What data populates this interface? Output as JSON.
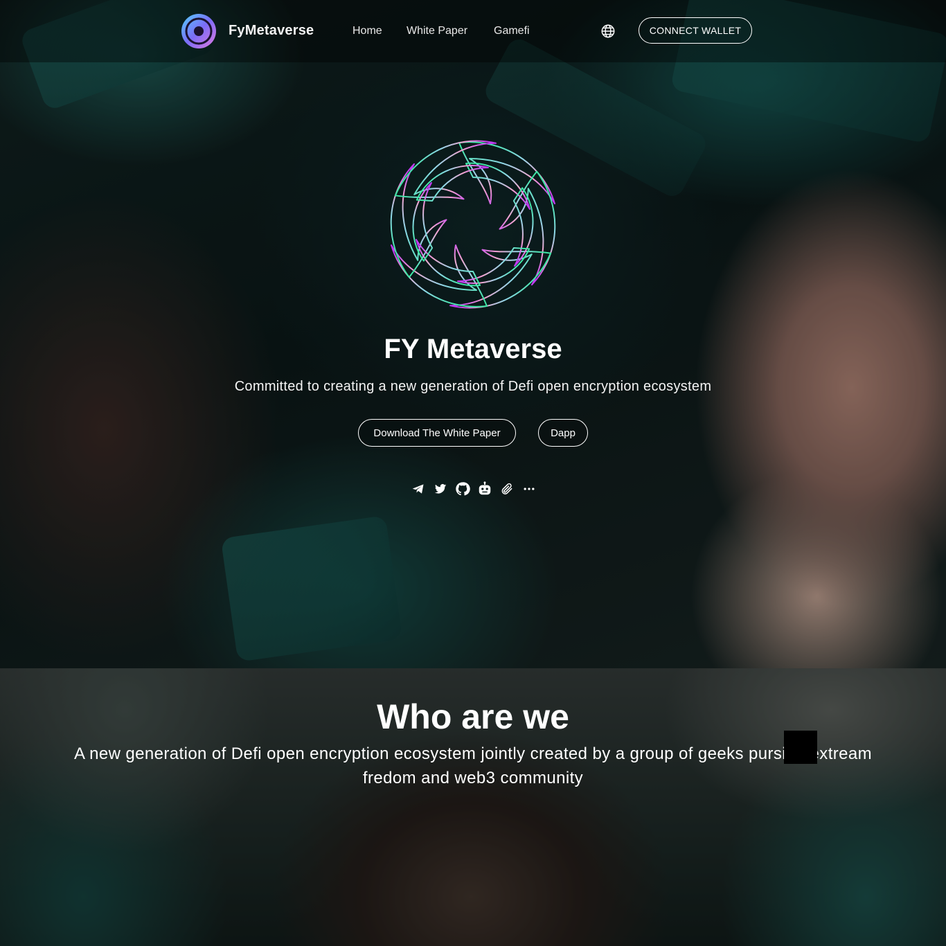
{
  "header": {
    "brand": "FyMetaverse",
    "nav": [
      {
        "label": "Home"
      },
      {
        "label": "White Paper"
      },
      {
        "label": "Gamefi"
      }
    ],
    "language_icon": "globe-icon",
    "connect_label": "CONNECT WALLET"
  },
  "hero": {
    "title": "FY Metaverse",
    "subtitle": "Committed to creating a new generation of Defi open encryption ecosystem",
    "buttons": {
      "whitepaper": "Download The White Paper",
      "dapp": "Dapp"
    },
    "socials": [
      "telegram-icon",
      "twitter-icon",
      "github-icon",
      "robot-icon",
      "paperclip-icon",
      "more-icon"
    ]
  },
  "about": {
    "title": "Who are we",
    "text": "A new generation of Defi open encryption ecosystem jointly created by a group of geeks pursing extream fredom and web3 community"
  },
  "colors": {
    "logo_gradient": [
      "#3ee6a6",
      "#7fb2ff",
      "#f07fd6",
      "#c03cf0"
    ],
    "text": "#ffffff"
  }
}
